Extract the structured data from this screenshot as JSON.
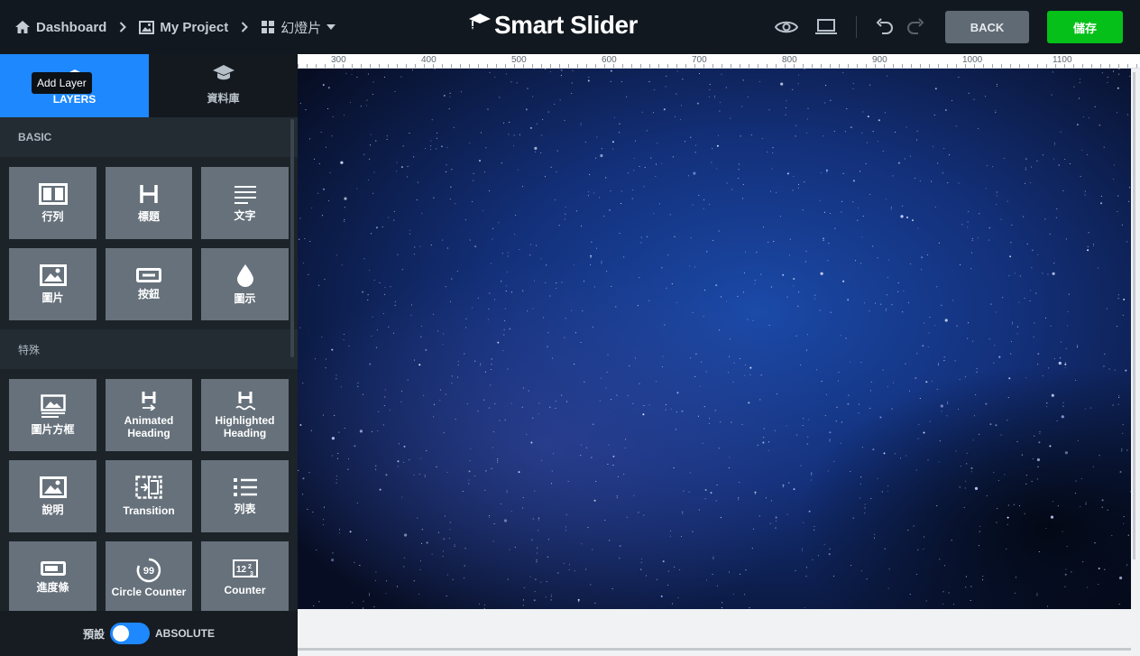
{
  "topbar": {
    "breadcrumb": [
      {
        "label": "Dashboard",
        "icon": "home-icon"
      },
      {
        "label": "My Project",
        "icon": "image-icon"
      },
      {
        "label": "幻燈片",
        "icon": "grid-icon"
      }
    ],
    "logo": "Smart Slider",
    "back_label": "BACK",
    "save_label": "儲存"
  },
  "sidebar": {
    "tabs": [
      {
        "label": "LAYERS",
        "icon": "layers-icon",
        "active": true
      },
      {
        "label": "資料庫",
        "icon": "graduation-cap-icon",
        "active": false
      }
    ],
    "tooltip": "Add Layer",
    "sections": [
      {
        "title": "BASIC",
        "items": [
          {
            "label": "行列",
            "icon": "row-icon"
          },
          {
            "label": "標題",
            "icon": "heading-icon"
          },
          {
            "label": "文字",
            "icon": "text-icon"
          },
          {
            "label": "圖片",
            "icon": "image-icon"
          },
          {
            "label": "按鈕",
            "icon": "button-icon"
          },
          {
            "label": "圖示",
            "icon": "drop-icon"
          }
        ]
      },
      {
        "title": "特殊",
        "items": [
          {
            "label": "圖片方框",
            "icon": "image-box-icon"
          },
          {
            "label": "Animated Heading",
            "icon": "animated-heading-icon"
          },
          {
            "label": "Highlighted Heading",
            "icon": "highlighted-heading-icon"
          },
          {
            "label": "說明",
            "icon": "caption-icon"
          },
          {
            "label": "Transition",
            "icon": "transition-icon"
          },
          {
            "label": "列表",
            "icon": "list-icon"
          },
          {
            "label": "進度條",
            "icon": "progress-bar-icon"
          },
          {
            "label": "Circle Counter",
            "icon": "circle-counter-icon"
          },
          {
            "label": "Counter",
            "icon": "counter-icon"
          }
        ]
      }
    ],
    "bottom": {
      "mode_left": "預設",
      "mode_right": "ABSOLUTE"
    }
  },
  "ruler": {
    "labels": [
      "300",
      "400",
      "500",
      "600",
      "700",
      "800",
      "900",
      "1000",
      "1100"
    ]
  },
  "colors": {
    "accent": "#1e88ff",
    "save": "#04c018",
    "topbar": "#111820",
    "tile": "#66717b"
  }
}
